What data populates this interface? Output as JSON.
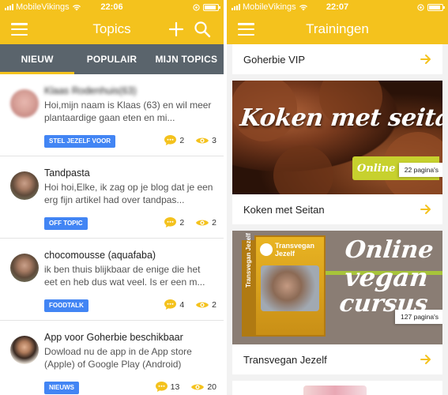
{
  "colors": {
    "brand": "#f4c21d",
    "tabbar": "#5a646c",
    "tag": "#4285f4"
  },
  "left": {
    "status": {
      "carrier": "MobileVikings",
      "time": "22:06"
    },
    "header": {
      "title": "Topics"
    },
    "tabs": [
      {
        "label": "NIEUW",
        "active": true
      },
      {
        "label": "POPULAIR",
        "active": false
      },
      {
        "label": "MIJN TOPICS",
        "active": false
      }
    ],
    "topics": [
      {
        "name": "Klaas Rodenhuis(63)",
        "excerpt": "Hoi,mijn naam is Klaas (63) en wil meer plantaardige gaan eten en mi...",
        "tag": "STEL JEZELF VOOR",
        "comments": "2",
        "views": "3"
      },
      {
        "name": "Tandpasta",
        "excerpt": "Hoi hoi,Elke, ik zag op je blog dat je een erg fijn artikel had over tandpas...",
        "tag": "OFF TOPIC",
        "comments": "2",
        "views": "2"
      },
      {
        "name": "chocomousse (aquafaba)",
        "excerpt": "ik ben thuis blijkbaar de enige die het eet en heb dus wat veel. Is er een m...",
        "tag": "FOODTALK",
        "comments": "4",
        "views": "2"
      },
      {
        "name": "App voor Goherbie beschikbaar",
        "excerpt": "Dowload nu de app in de App store (Apple) of Google Play (Android)",
        "tag": "NIEUWS",
        "comments": "13",
        "views": "20"
      }
    ]
  },
  "right": {
    "status": {
      "carrier": "MobileVikings",
      "time": "22:07"
    },
    "header": {
      "title": "Trainingen"
    },
    "cards": [
      {
        "title": "Goherbie VIP"
      },
      {
        "title": "Koken met Seitan",
        "image_text": "Koken met seitan",
        "badge": "Online",
        "pages": "22 pagina's"
      },
      {
        "title": "Transvegan Jezelf",
        "image_text": [
          "Online",
          "vegan",
          "cursus"
        ],
        "book_title": "Transvegan Jezelf",
        "book_spine": "Transvegan Jezelf",
        "pages": "127 pagina's"
      }
    ]
  }
}
